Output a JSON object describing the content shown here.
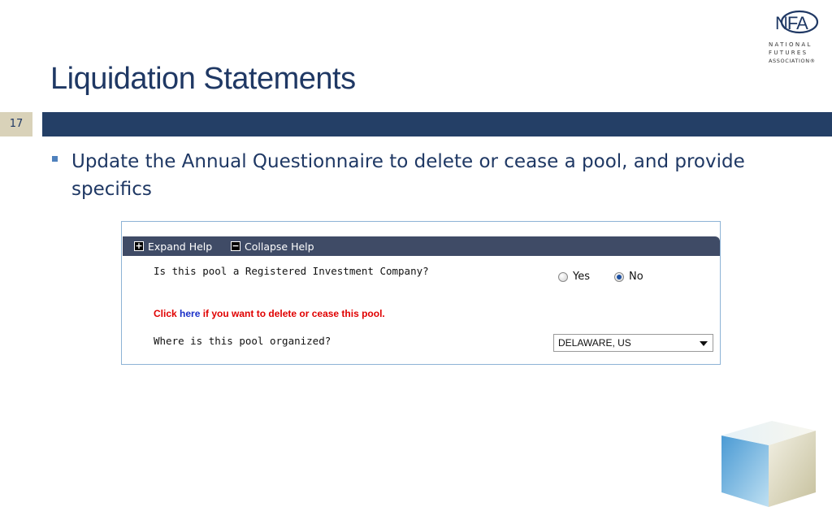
{
  "logo": {
    "abbr": "NFA",
    "lines": [
      "NATIONAL",
      "FUTURES",
      "ASSOCIATION®"
    ]
  },
  "slide": {
    "title": "Liquidation Statements",
    "page_number": "17",
    "bullet": "Update the Annual Questionnaire to delete or cease a pool, and provide specifics"
  },
  "form": {
    "expand_label": "Expand Help",
    "collapse_label": "Collapse Help",
    "question_ric": "Is this pool a Registered Investment Company?",
    "yes_label": "Yes",
    "no_label": "No",
    "selected_option": "No",
    "notice_prefix": "Click ",
    "notice_link": "here",
    "notice_suffix": " if you want to delete or cease this pool.",
    "question_org": "Where is this pool organized?",
    "org_value": "DELAWARE, US"
  },
  "colors": {
    "title": "#1f3864",
    "bar": "#243f66",
    "page_tab": "#d9d2b9",
    "help_bar": "#3f4b66",
    "notice": "#e00000",
    "link": "#1a30c8"
  }
}
